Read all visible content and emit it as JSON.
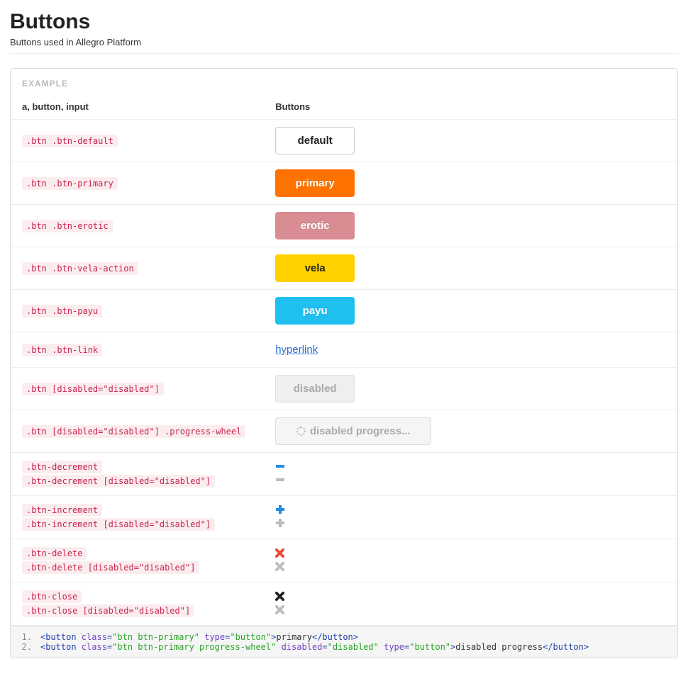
{
  "header": {
    "title": "Buttons",
    "subtitle": "Buttons used in Allegro Platform"
  },
  "example_label": "EXAMPLE",
  "table": {
    "col1": "a, button, input",
    "col2": "Buttons"
  },
  "rows": {
    "default": {
      "selector": ".btn .btn-default",
      "label": "default"
    },
    "primary": {
      "selector": ".btn .btn-primary",
      "label": "primary"
    },
    "erotic": {
      "selector": ".btn .btn-erotic",
      "label": "erotic"
    },
    "vela": {
      "selector": ".btn .btn-vela-action",
      "label": "vela"
    },
    "payu": {
      "selector": ".btn .btn-payu",
      "label": "payu"
    },
    "link": {
      "selector": ".btn .btn-link",
      "label": "hyperlink"
    },
    "disabled": {
      "selector": ".btn [disabled=\"disabled\"]",
      "label": "disabled"
    },
    "disabled_progress": {
      "selector": ".btn [disabled=\"disabled\"] .progress-wheel",
      "label": "disabled progress..."
    },
    "decrement": {
      "selector_active": ".btn-decrement",
      "selector_disabled": ".btn-decrement [disabled=\"disabled\"]"
    },
    "increment": {
      "selector_active": ".btn-increment",
      "selector_disabled": ".btn-increment [disabled=\"disabled\"]"
    },
    "delete": {
      "selector_active": ".btn-delete",
      "selector_disabled": ".btn-delete [disabled=\"disabled\"]"
    },
    "close": {
      "selector_active": ".btn-close",
      "selector_disabled": ".btn-close [disabled=\"disabled\"]"
    }
  },
  "code": {
    "line1": {
      "no": "1.",
      "open1": "<button ",
      "attr1": "class",
      "eq": "=",
      "val1": "\"btn btn-primary\"",
      "sp": " ",
      "attr2": "type",
      "val2": "\"button\"",
      "close1": ">",
      "text": "primary",
      "end": "</button>"
    },
    "line2": {
      "no": "2.",
      "open1": "<button ",
      "attr1": "class",
      "eq": "=",
      "val1": "\"btn btn-primary progress-wheel\"",
      "sp": " ",
      "attr2": "disabled",
      "val2": "\"disabled\"",
      "attr3": "type",
      "val3": "\"button\"",
      "close1": ">",
      "text": "disabled progress",
      "end": "</button>"
    }
  }
}
